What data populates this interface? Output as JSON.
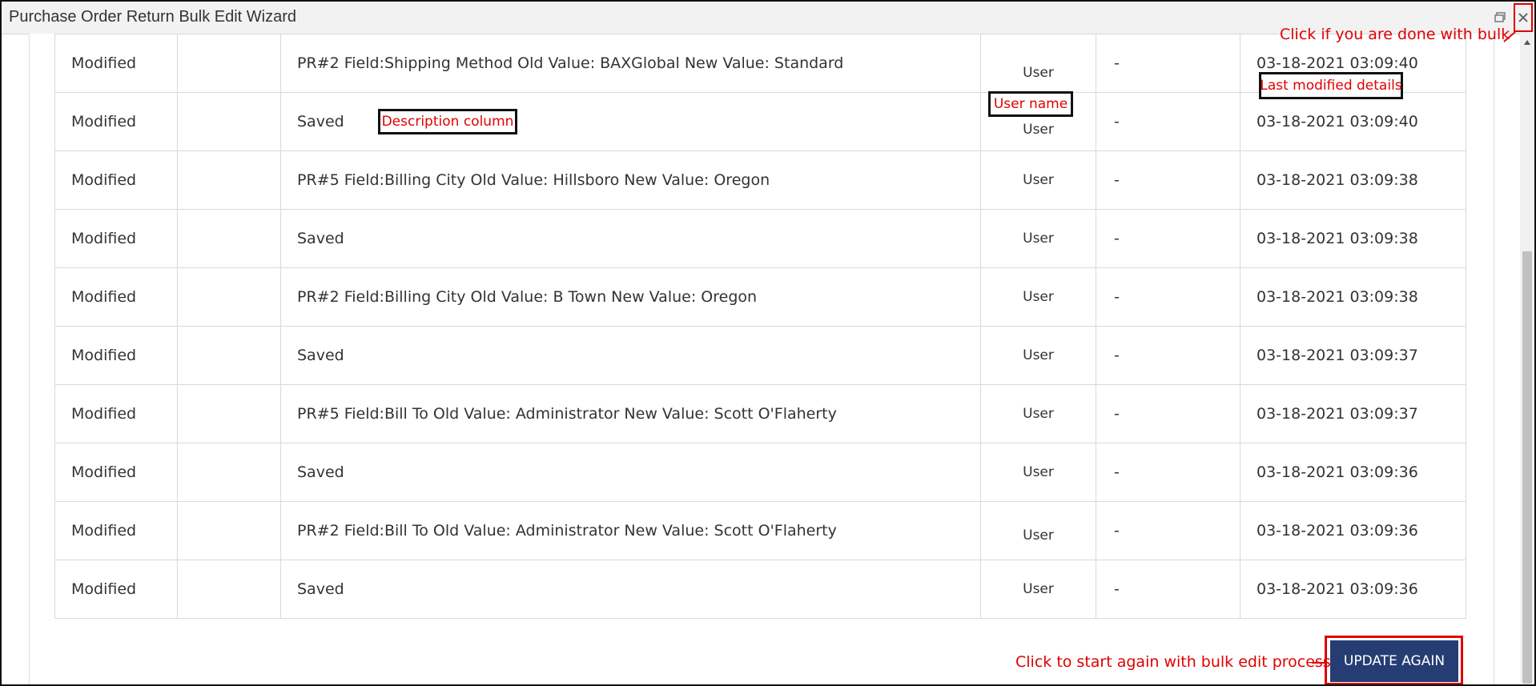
{
  "window": {
    "title": "Purchase Order Return Bulk Edit Wizard",
    "restore_icon": "restore-window-icon",
    "close_icon": "close-icon"
  },
  "rows": [
    {
      "action": "Modified",
      "description": "PR#2 Field:Shipping Method Old Value: BAXGlobal New Value: Standard",
      "user": "User",
      "extra": "-",
      "date": "03-18-2021 03:09:40"
    },
    {
      "action": "Modified",
      "description": "Saved",
      "user": "User",
      "extra": "-",
      "date": "03-18-2021 03:09:40"
    },
    {
      "action": "Modified",
      "description": "PR#5 Field:Billing City Old Value: Hillsboro New Value: Oregon",
      "user": "User",
      "extra": "-",
      "date": "03-18-2021 03:09:38"
    },
    {
      "action": "Modified",
      "description": "Saved",
      "user": "User",
      "extra": "-",
      "date": "03-18-2021 03:09:38"
    },
    {
      "action": "Modified",
      "description": "PR#2 Field:Billing City Old Value: B Town New Value: Oregon",
      "user": "User",
      "extra": "-",
      "date": "03-18-2021 03:09:38"
    },
    {
      "action": "Modified",
      "description": "Saved",
      "user": "User",
      "extra": "-",
      "date": "03-18-2021 03:09:37"
    },
    {
      "action": "Modified",
      "description": "PR#5 Field:Bill To Old Value: Administrator New Value: Scott O'Flaherty",
      "user": "User",
      "extra": "-",
      "date": "03-18-2021 03:09:37"
    },
    {
      "action": "Modified",
      "description": "Saved",
      "user": "User",
      "extra": "-",
      "date": "03-18-2021 03:09:36"
    },
    {
      "action": "Modified",
      "description": "PR#2 Field:Bill To Old Value: Administrator New Value: Scott O'Flaherty",
      "user": "User",
      "extra": "-",
      "date": "03-18-2021 03:09:36"
    },
    {
      "action": "Modified",
      "description": "Saved",
      "user": "User",
      "extra": "-",
      "date": "03-18-2021 03:09:36"
    }
  ],
  "annotations": {
    "close_hint": "Click if you are done with bulk",
    "last_modified": "Last modified details",
    "user_name": "User name",
    "description_column": "Description column",
    "update_hint": "Click to start again with bulk edit process"
  },
  "buttons": {
    "update_again": "UPDATE AGAIN"
  },
  "colors": {
    "annotation": "#e00000",
    "button_bg": "#253d73"
  }
}
